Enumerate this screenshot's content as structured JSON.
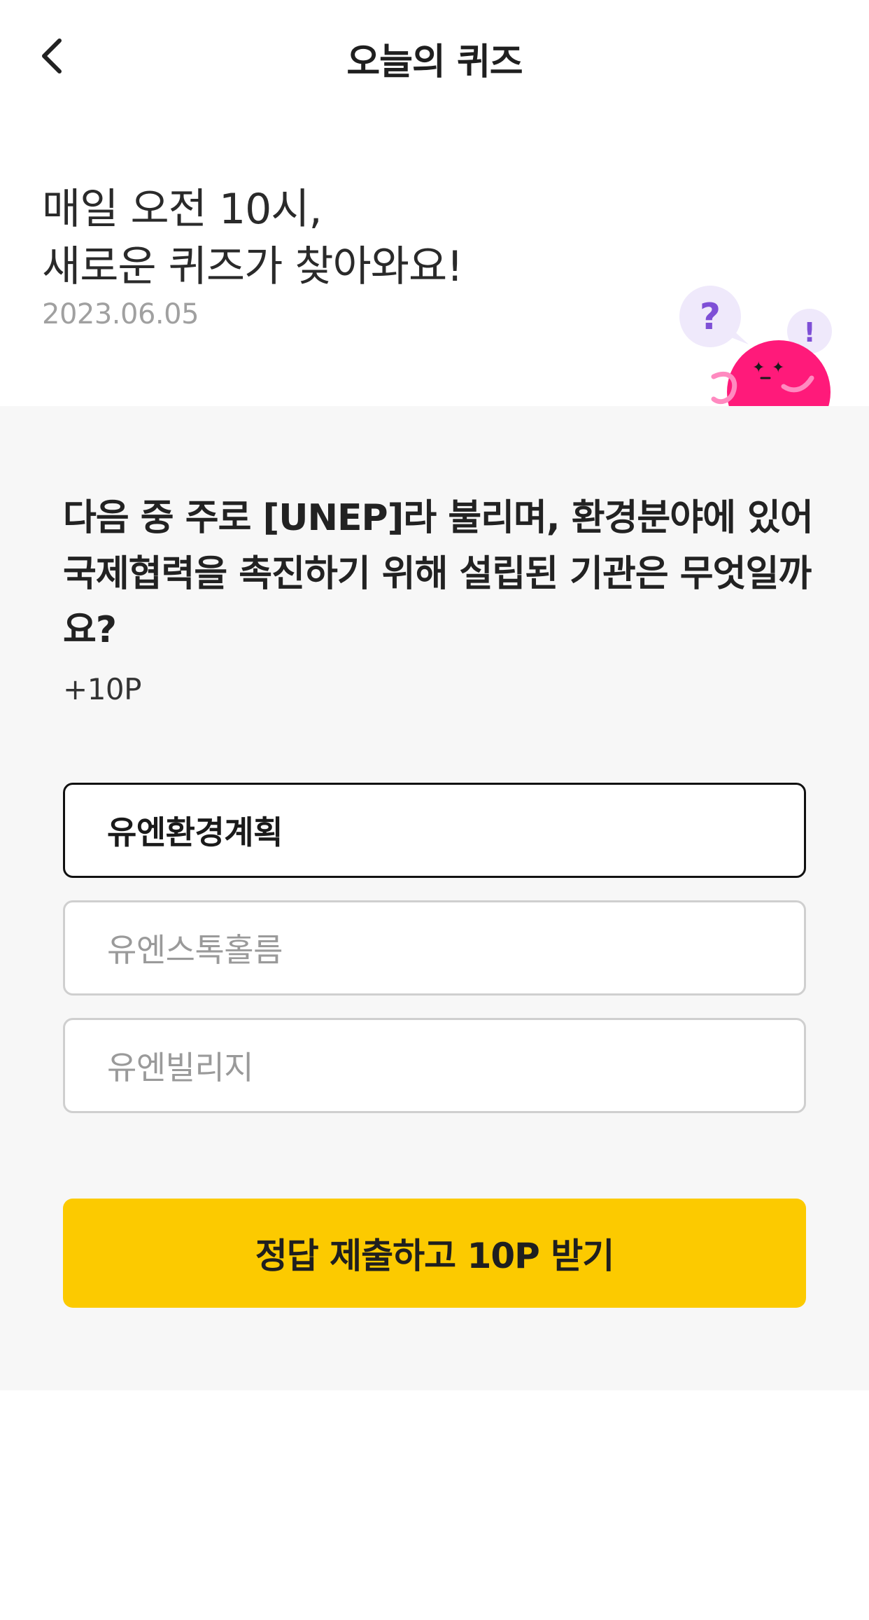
{
  "header": {
    "title": "오늘의 퀴즈",
    "back_icon": "chevron-left-icon"
  },
  "intro": {
    "line1": "매일 오전 10시,",
    "line2": "새로운 퀴즈가 찾아와요!",
    "date": "2023.06.05"
  },
  "mascot": {
    "bubble_left": "?",
    "bubble_right": "!",
    "body_color": "#ff1a7a",
    "bubble_color": "#efe9fb",
    "accent_color": "#7e4fd6"
  },
  "quiz": {
    "question": "다음 중 주로 [UNEP]라 불리며, 환경분야에 있어 국제협력을 촉진하기 위해 설립된 기관은 무엇일까요?",
    "points": "+10P",
    "options": [
      {
        "label": "유엔환경계획",
        "selected": true
      },
      {
        "label": "유엔스톡홀름",
        "selected": false
      },
      {
        "label": "유엔빌리지",
        "selected": false
      }
    ],
    "submit_label": "정답 제출하고 10P 받기"
  },
  "colors": {
    "accent": "#fcca00",
    "section_bg": "#f7f7f7",
    "selected_border": "#111111",
    "option_border": "#cfcfcf"
  }
}
